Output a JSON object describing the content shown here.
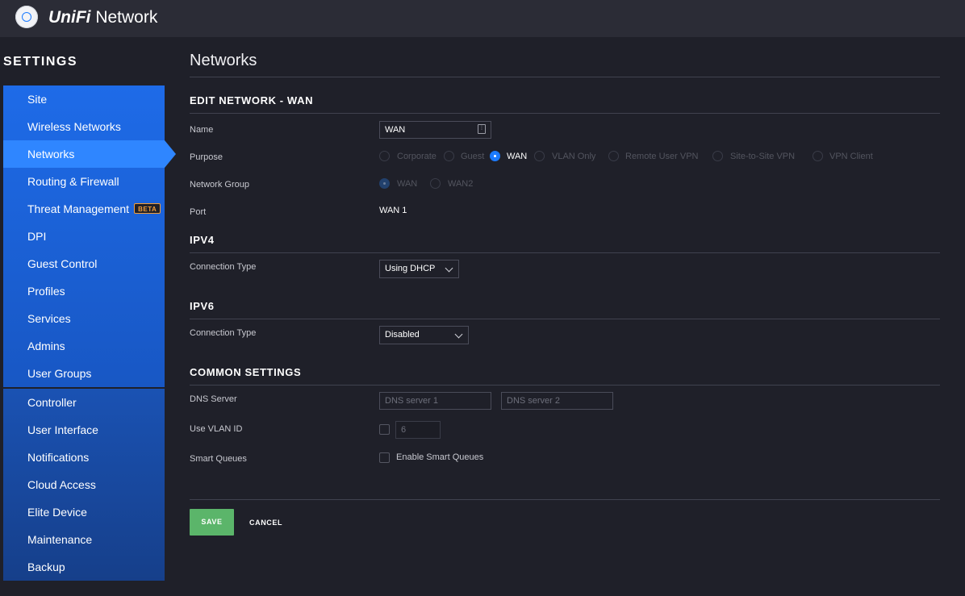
{
  "app": {
    "brand_first": "UniFi",
    "brand_second": " Network"
  },
  "sidebar": {
    "title": "SETTINGS",
    "items": [
      {
        "label": "Site"
      },
      {
        "label": "Wireless Networks"
      },
      {
        "label": "Networks"
      },
      {
        "label": "Routing & Firewall"
      },
      {
        "label": "Threat Management",
        "badge": "BETA"
      },
      {
        "label": "DPI"
      },
      {
        "label": "Guest Control"
      },
      {
        "label": "Profiles"
      },
      {
        "label": "Services"
      },
      {
        "label": "Admins"
      },
      {
        "label": "User Groups"
      },
      {
        "label": "Controller"
      },
      {
        "label": "User Interface"
      },
      {
        "label": "Notifications"
      },
      {
        "label": "Cloud Access"
      },
      {
        "label": "Elite Device"
      },
      {
        "label": "Maintenance"
      },
      {
        "label": "Backup"
      }
    ]
  },
  "main": {
    "page_title": "Networks",
    "edit_section": {
      "title": "EDIT NETWORK - WAN",
      "name_label": "Name",
      "name_value": "WAN",
      "purpose_label": "Purpose",
      "purpose_options": [
        "Corporate",
        "Guest",
        "WAN",
        "VLAN Only",
        "Remote User VPN",
        "Site-to-Site VPN",
        "VPN Client"
      ],
      "purpose_selected": "WAN",
      "network_group_label": "Network Group",
      "network_group_options": [
        "WAN",
        "WAN2"
      ],
      "network_group_selected": "WAN",
      "port_label": "Port",
      "port_value": "WAN 1"
    },
    "ipv4": {
      "title": "IPV4",
      "connection_type_label": "Connection Type",
      "connection_type_value": "Using DHCP"
    },
    "ipv6": {
      "title": "IPV6",
      "connection_type_label": "Connection Type",
      "connection_type_value": "Disabled"
    },
    "common": {
      "title": "COMMON SETTINGS",
      "dns_label": "DNS Server",
      "dns1_placeholder": "DNS server 1",
      "dns2_placeholder": "DNS server 2",
      "vlan_label": "Use VLAN ID",
      "vlan_placeholder": "6",
      "vlan_checked": false,
      "smart_queues_label": "Smart Queues",
      "smart_queues_option": "Enable Smart Queues",
      "smart_queues_checked": false
    },
    "actions": {
      "save": "SAVE",
      "cancel": "CANCEL"
    }
  },
  "colors": {
    "accent": "#1c7bff",
    "sidebar": "#1e6be8",
    "save": "#5bb56a",
    "beta": "#f29d38"
  }
}
